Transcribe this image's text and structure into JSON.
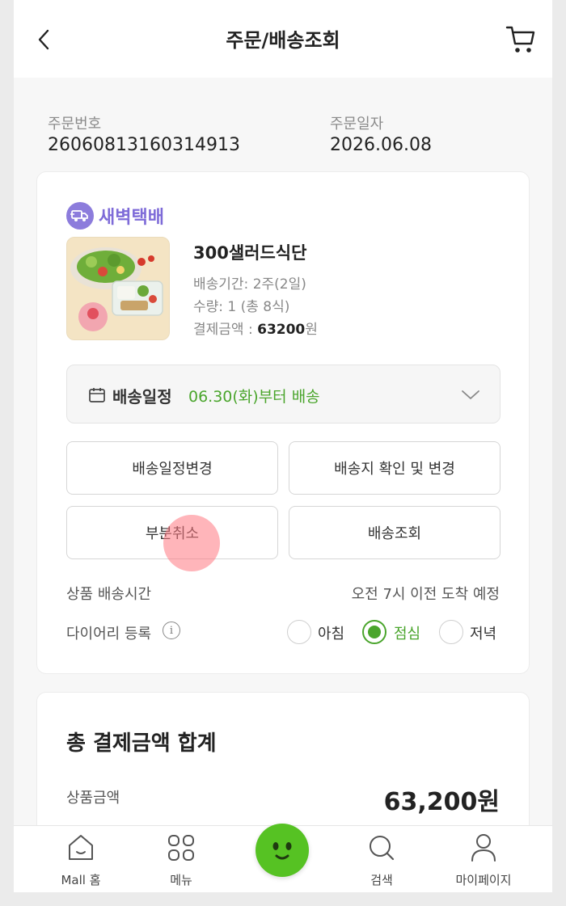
{
  "header": {
    "title": "주문/배송조회"
  },
  "order": {
    "number_label": "주문번호",
    "number": "26060813160314913",
    "date_label": "주문일자",
    "date": "2026.06.08"
  },
  "item": {
    "delivery_type": "새벽택배",
    "name": "300샐러드식단",
    "period": "배송기간: 2주(2일)",
    "quantity": "수량: 1 (총 8식)",
    "payment_prefix": "결제금액 : ",
    "payment_amount": "63200",
    "payment_unit": "원",
    "image_caption": "다양한 채소"
  },
  "schedule": {
    "label": "배송일정",
    "value": "06.30(화)부터 배송"
  },
  "buttons": {
    "change_schedule": "배송일정변경",
    "address": "배송지 확인 및 변경",
    "partial_cancel": "부분취소",
    "tracking": "배송조회"
  },
  "delivery_time": {
    "label": "상품 배송시간",
    "value": "오전 7시 이전 도착 예정"
  },
  "diary": {
    "label": "다이어리 등록",
    "options": [
      "아침",
      "점심",
      "저녁"
    ],
    "selected": "점심"
  },
  "total": {
    "title": "총 결제금액 합계",
    "product_label": "상품금액",
    "product_value": "63,200원"
  },
  "nav": {
    "items": [
      "Mall 홈",
      "메뉴",
      "검색",
      "마이페이지"
    ]
  },
  "colors": {
    "accent_green": "#4aa52c",
    "badge_purple": "#7e6bd8",
    "center_button": "#56c223"
  }
}
